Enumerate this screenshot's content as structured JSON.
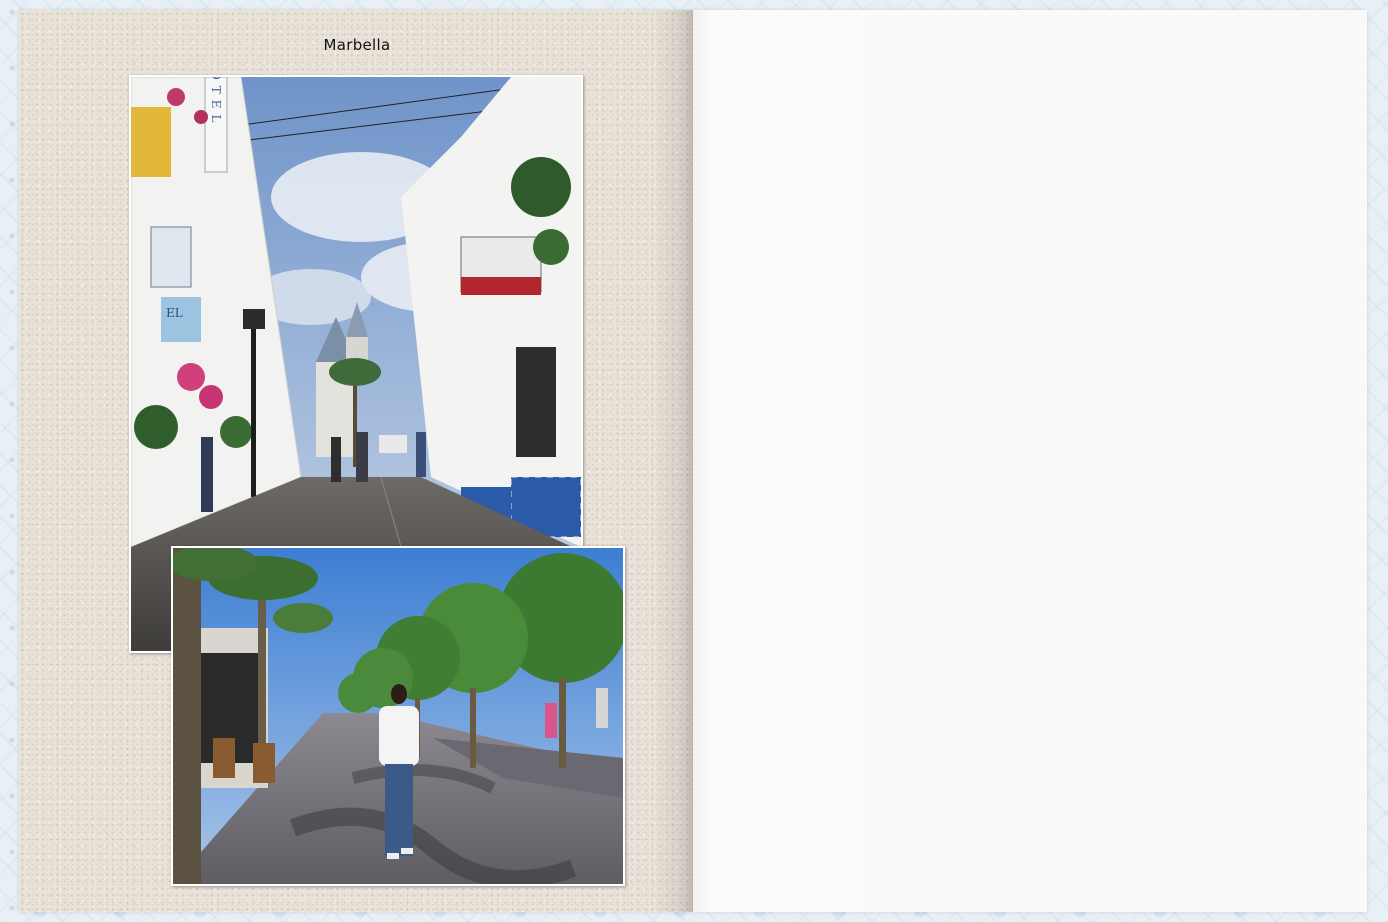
{
  "album": {
    "left_page": {
      "title": "Marbella",
      "photos": [
        {
          "name": "street-photo",
          "signs": [
            "HOTEL",
            "EL"
          ]
        },
        {
          "name": "promenade-photo"
        }
      ]
    },
    "right_page": {}
  }
}
